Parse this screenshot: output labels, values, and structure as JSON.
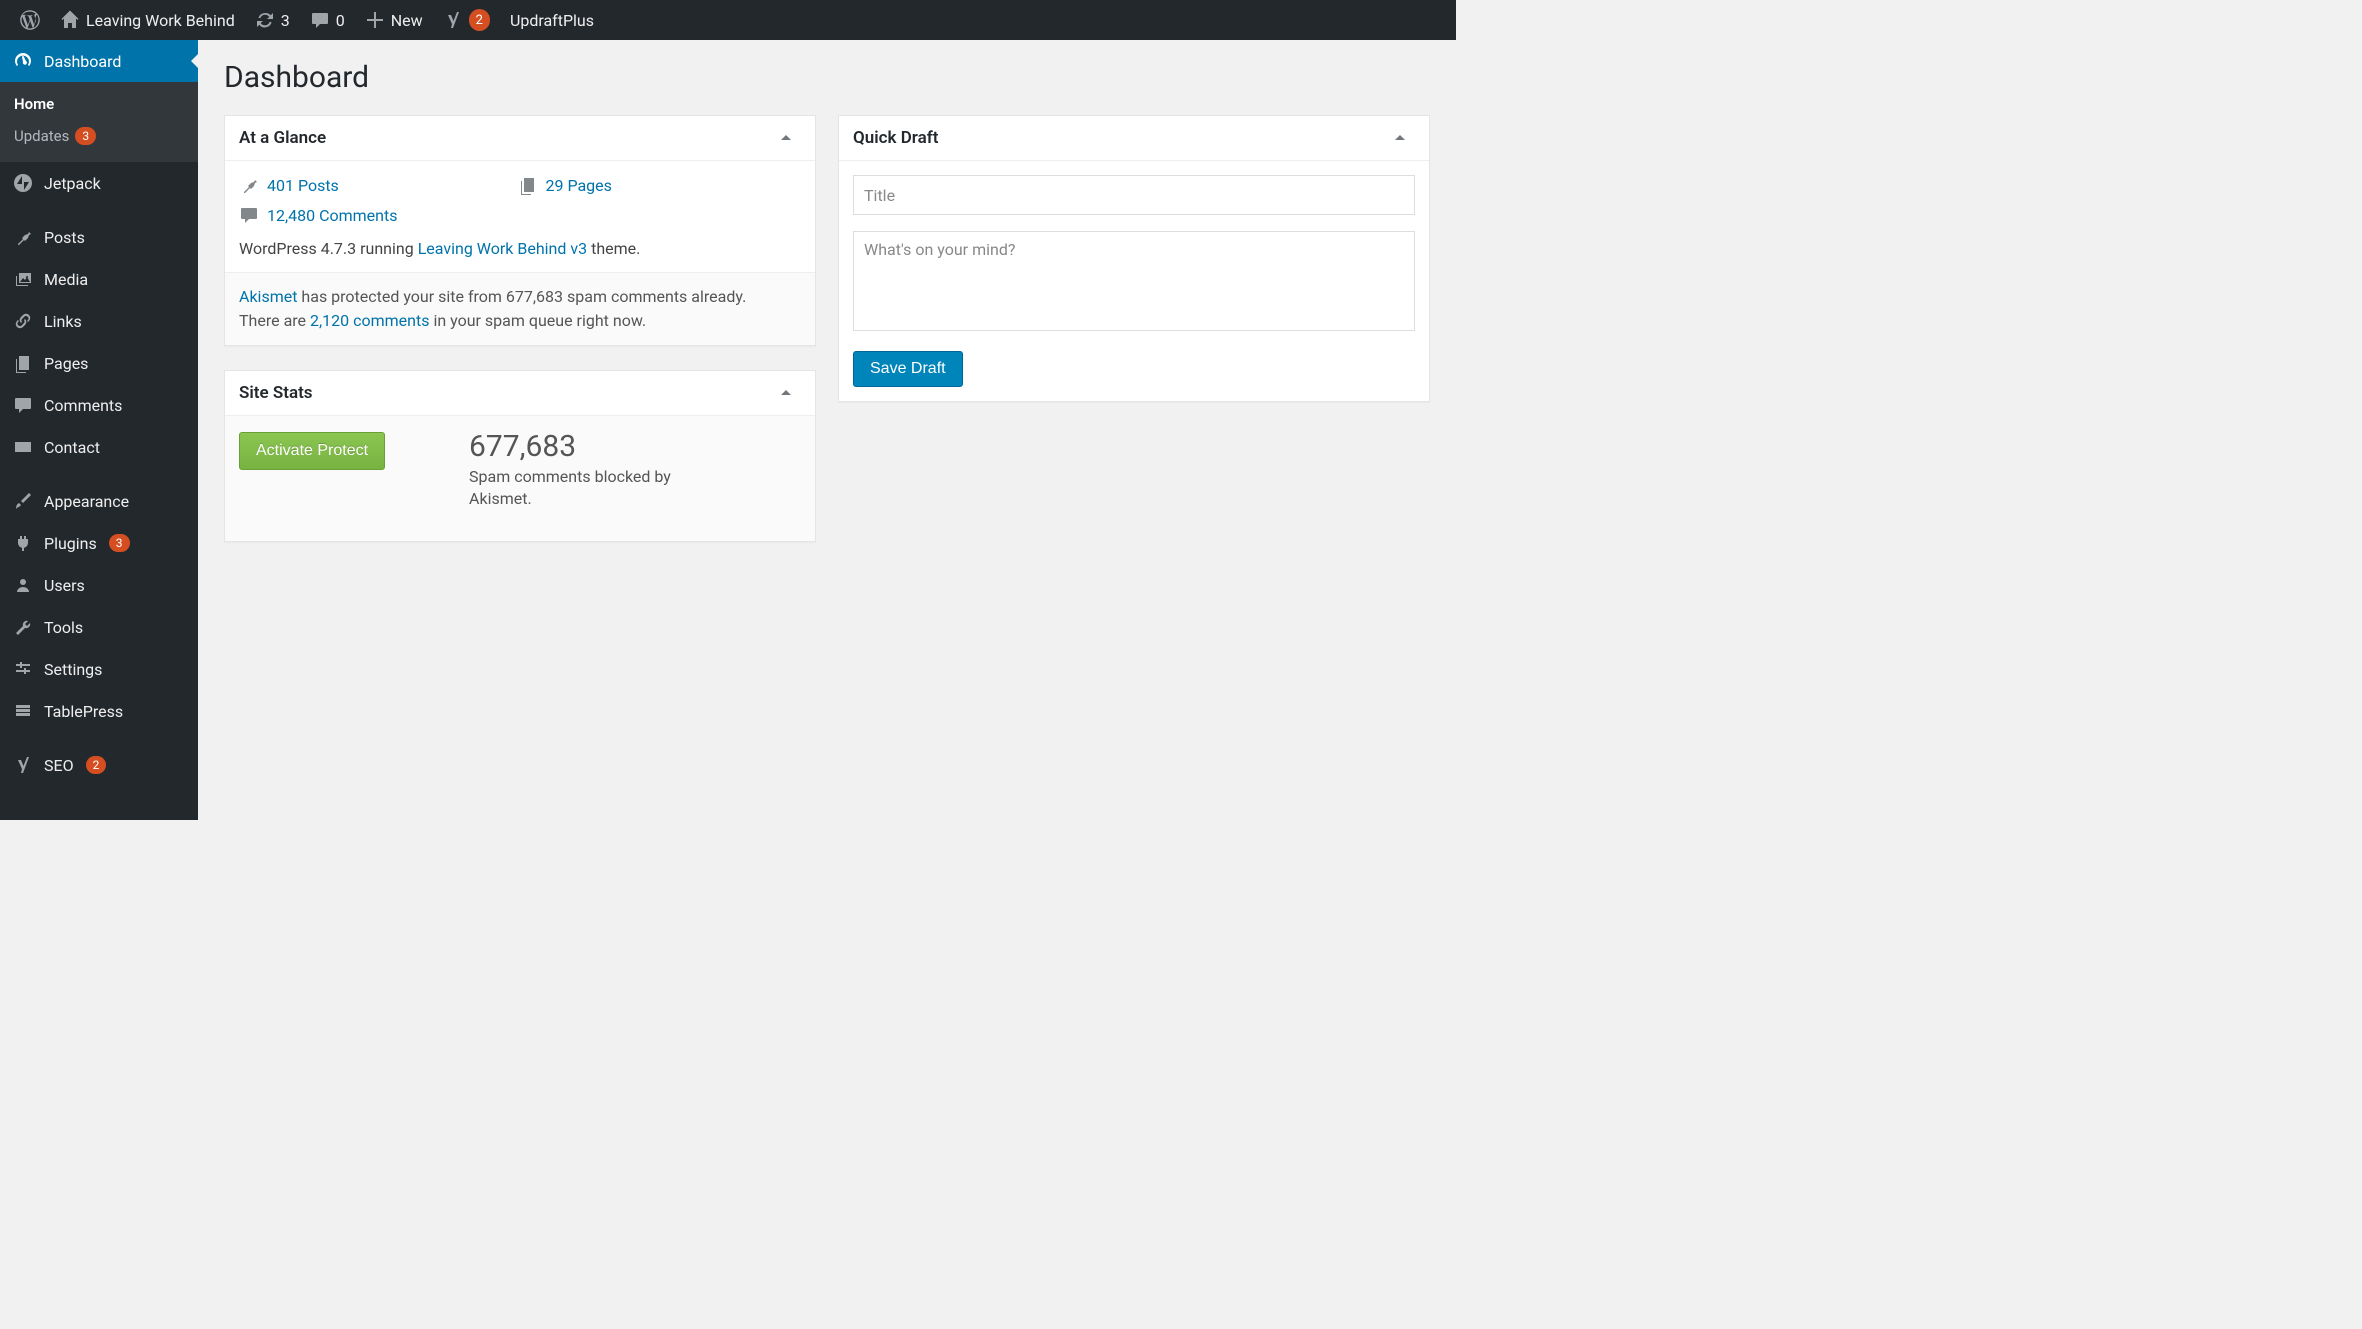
{
  "adminbar": {
    "site_title": "Leaving Work Behind",
    "updates_count": "3",
    "comments_count": "0",
    "new_label": "New",
    "yoast_badge": "2",
    "updraft_label": "UpdraftPlus"
  },
  "sidebar": {
    "dashboard": {
      "label": "Dashboard"
    },
    "submenu": {
      "home": "Home",
      "updates": "Updates",
      "updates_badge": "3"
    },
    "items": [
      {
        "label": "Jetpack"
      },
      {
        "label": "Posts"
      },
      {
        "label": "Media"
      },
      {
        "label": "Links"
      },
      {
        "label": "Pages"
      },
      {
        "label": "Comments"
      },
      {
        "label": "Contact"
      },
      {
        "label": "Appearance"
      },
      {
        "label": "Plugins",
        "badge": "3"
      },
      {
        "label": "Users"
      },
      {
        "label": "Tools"
      },
      {
        "label": "Settings"
      },
      {
        "label": "TablePress"
      },
      {
        "label": "SEO",
        "badge": "2"
      }
    ]
  },
  "page": {
    "title": "Dashboard"
  },
  "glance": {
    "title": "At a Glance",
    "posts_link": "401 Posts",
    "pages_link": "29 Pages",
    "comments_link": "12,480 Comments",
    "version_prefix": "WordPress 4.7.3 running ",
    "theme_link": "Leaving Work Behind v3",
    "version_suffix": " theme.",
    "akismet_link": "Akismet",
    "akismet_line1_rest": " has protected your site from 677,683 spam comments already.",
    "akismet_line2_prefix": "There are ",
    "spam_queue_link": "2,120 comments",
    "akismet_line2_suffix": " in your spam queue right now."
  },
  "stats": {
    "title": "Site Stats",
    "activate_label": "Activate Protect",
    "big_number": "677,683",
    "label": "Spam comments blocked by Akismet."
  },
  "quickdraft": {
    "title": "Quick Draft",
    "title_placeholder": "Title",
    "content_placeholder": "What's on your mind?",
    "save_label": "Save Draft"
  }
}
